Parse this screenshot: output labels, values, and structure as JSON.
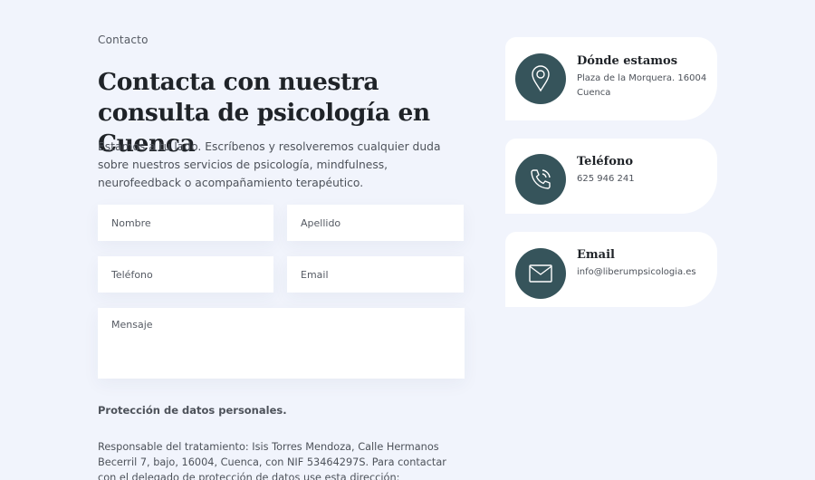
{
  "breadcrumb": "Contacto",
  "page_title": "Contacta con nuestra consulta de psicología en Cuenca",
  "lead": "Estamos a tu lado. Escríbenos y resolveremos cualquier duda sobre nuestros servicios de psicología, mindfulness, neurofeedback o acompañamiento terapéutico.",
  "form": {
    "name_placeholder": "Nombre",
    "lastname_placeholder": "Apellido",
    "phone_placeholder": "Teléfono",
    "email_placeholder": "Email",
    "message_placeholder": "Mensaje"
  },
  "privacy": {
    "title": "Protección de datos personales.",
    "text": "Responsable del tratamiento: Isis Torres Mendoza, Calle Hermanos Becerril 7, bajo, 16004, Cuenca, con NIF 53464297S. Para contactar con el delegado de protección de datos use esta dirección:"
  },
  "cards": {
    "location": {
      "icon": "location-pin-icon",
      "title": "Dónde estamos",
      "text": "Plaza de la Morquera. 16004 Cuenca"
    },
    "phone": {
      "icon": "phone-icon",
      "title": "Teléfono",
      "text": "625 946 241"
    },
    "email": {
      "icon": "envelope-icon",
      "title": "Email",
      "text": "info@liberumpsicologia.es"
    }
  },
  "colors": {
    "background": "#f1f4fc",
    "icon_circle": "#36545b",
    "heading": "#1f2328",
    "text": "#4d525a"
  }
}
